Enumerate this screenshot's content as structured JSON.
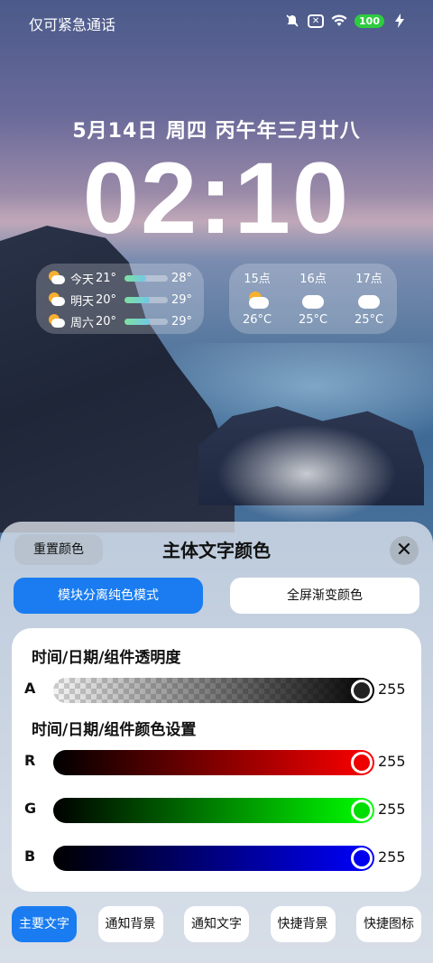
{
  "status_bar": {
    "carrier_text": "仅可紧急通话",
    "icons": [
      "bell-muted-icon",
      "sim-none-icon",
      "wifi-icon",
      "battery-icon",
      "charging-icon"
    ],
    "battery_level": "100"
  },
  "lockscreen": {
    "date": "5月14日 周四 丙午年三月廿八",
    "time": "02:10"
  },
  "weather_daily": [
    {
      "day": "今天",
      "low": "21°",
      "high": "28°",
      "icon": "partly-cloudy-icon"
    },
    {
      "day": "明天",
      "low": "20°",
      "high": "29°",
      "icon": "partly-cloudy-icon"
    },
    {
      "day": "周六",
      "low": "20°",
      "high": "29°",
      "icon": "partly-cloudy-icon"
    }
  ],
  "weather_hourly": [
    {
      "hour": "15点",
      "temp": "26°C",
      "icon": "partly-cloudy-icon"
    },
    {
      "hour": "16点",
      "temp": "25°C",
      "icon": "cloudy-icon"
    },
    {
      "hour": "17点",
      "temp": "25°C",
      "icon": "cloudy-icon"
    }
  ],
  "sheet": {
    "reset_label": "重置颜色",
    "title": "主体文字颜色",
    "close_icon": "close-icon",
    "modes": [
      {
        "label": "模块分离纯色模式",
        "active": true
      },
      {
        "label": "全屏渐变颜色",
        "active": false
      }
    ],
    "opacity_title": "时间/日期/组件透明度",
    "color_title": "时间/日期/组件颜色设置",
    "sliders": [
      {
        "label": "A",
        "value": "255",
        "color": "#000000"
      },
      {
        "label": "R",
        "value": "255",
        "color": "#ff0000"
      },
      {
        "label": "G",
        "value": "255",
        "color": "#00ff00"
      },
      {
        "label": "B",
        "value": "255",
        "color": "#0000ff"
      }
    ],
    "tabs": [
      {
        "label": "主要文字",
        "active": true
      },
      {
        "label": "通知背景",
        "active": false
      },
      {
        "label": "通知文字",
        "active": false
      },
      {
        "label": "快捷背景",
        "active": false
      },
      {
        "label": "快捷图标",
        "active": false
      }
    ]
  },
  "colors": {
    "accent": "#1a7cf0",
    "battery": "#2ecc40"
  }
}
